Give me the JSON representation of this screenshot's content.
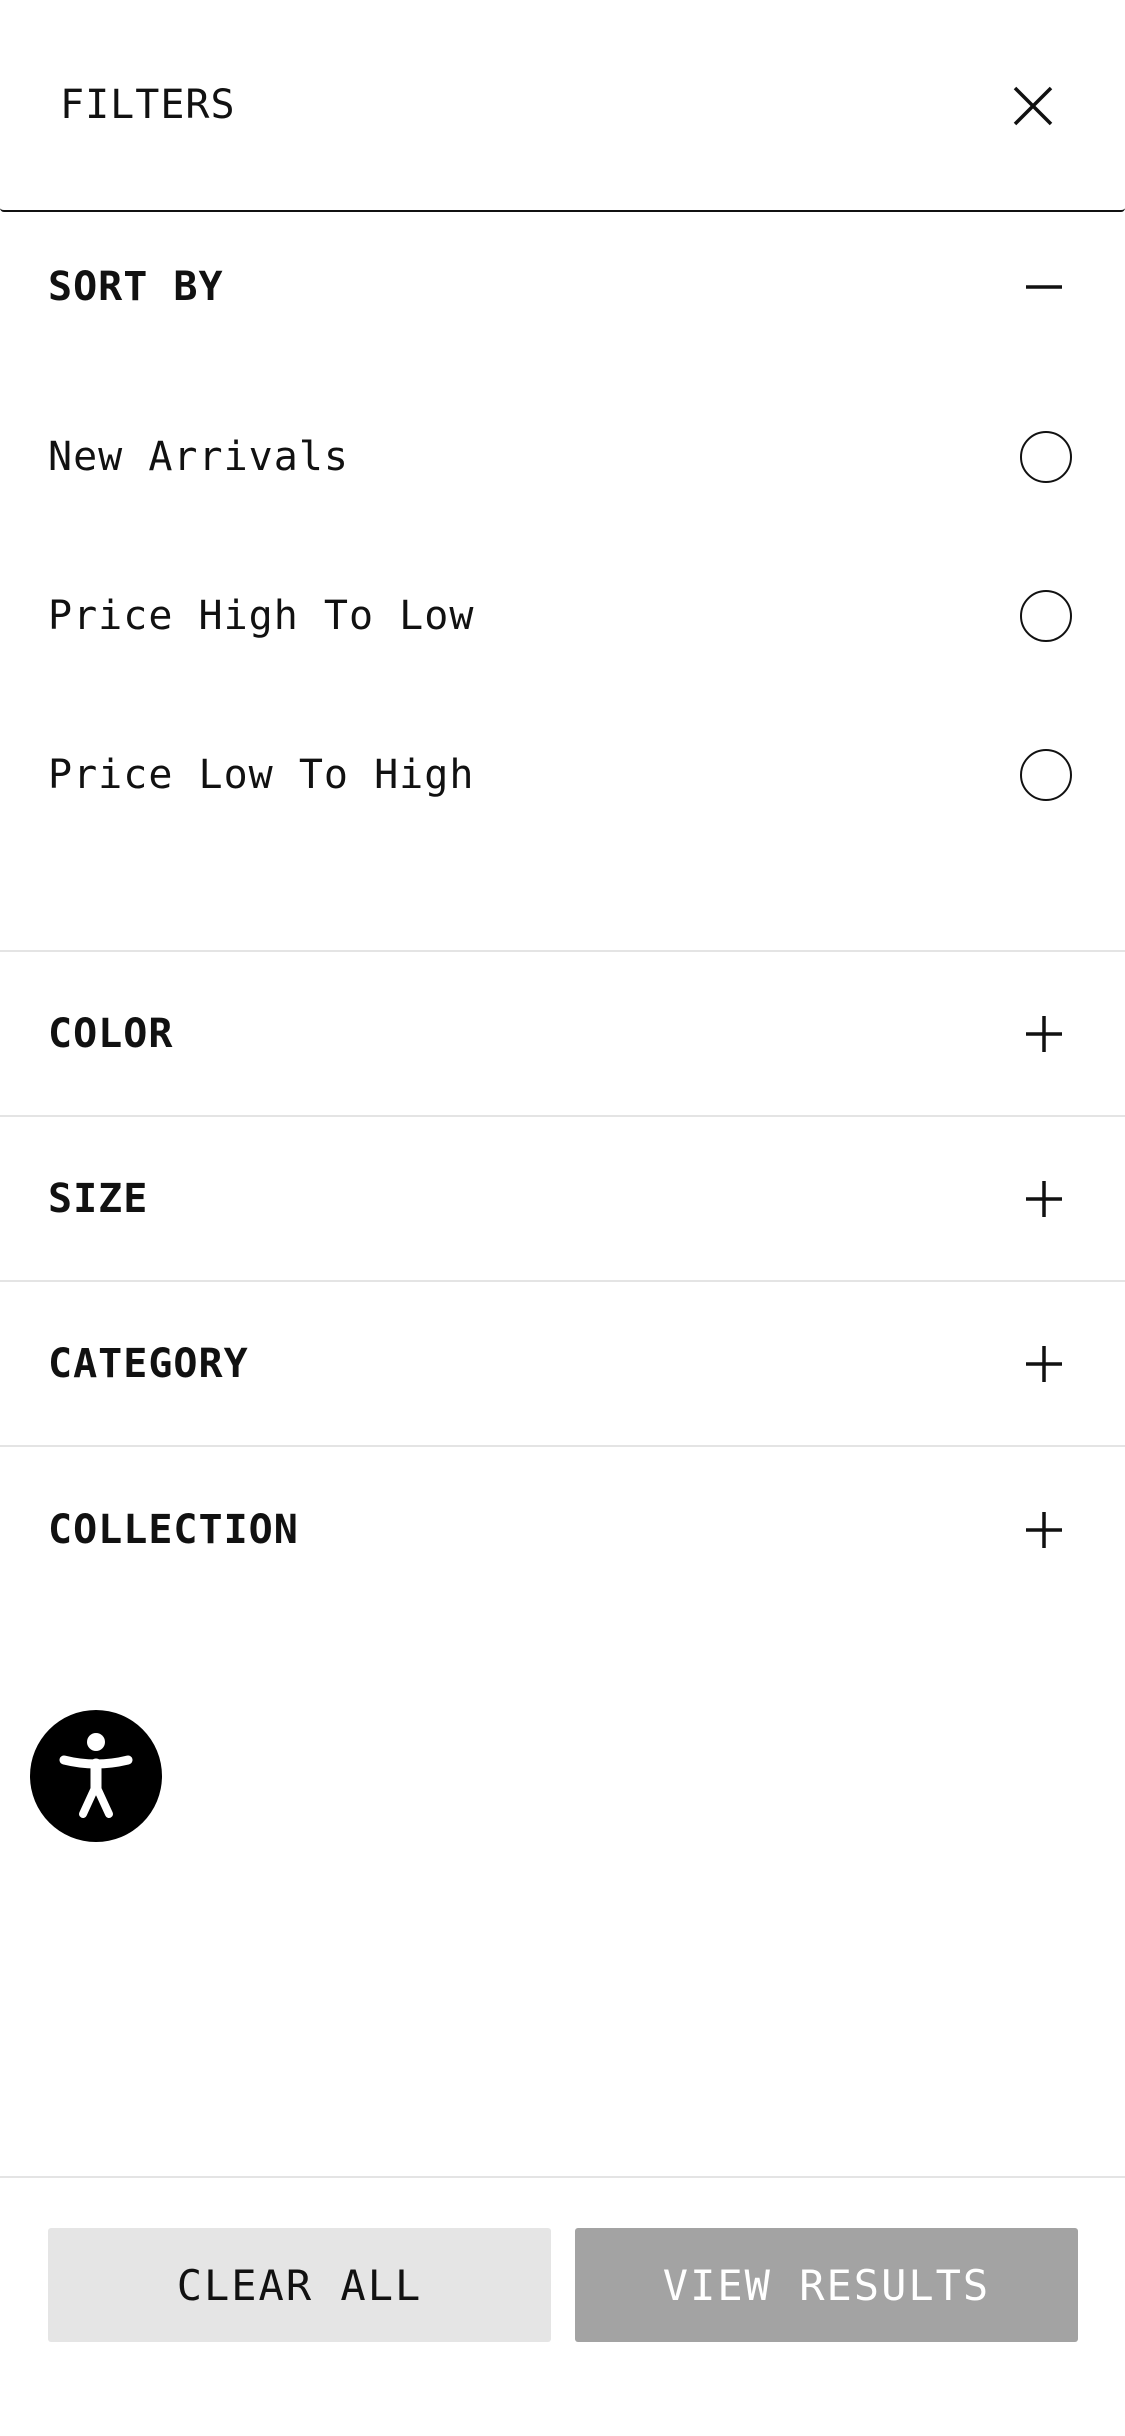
{
  "header": {
    "title": "FILTERS",
    "close_icon": "close-icon"
  },
  "sort": {
    "label": "SORT BY",
    "toggle_icon": "minus-icon",
    "options": [
      {
        "label": "New Arrivals",
        "selected": false
      },
      {
        "label": "Price High To Low",
        "selected": false
      },
      {
        "label": "Price Low To High",
        "selected": false
      }
    ]
  },
  "filters": [
    {
      "label": "COLOR",
      "toggle_icon": "plus-icon"
    },
    {
      "label": "SIZE",
      "toggle_icon": "plus-icon"
    },
    {
      "label": "CATEGORY",
      "toggle_icon": "plus-icon"
    },
    {
      "label": "COLLECTION",
      "toggle_icon": "plus-icon"
    }
  ],
  "accessibility": {
    "icon": "accessibility-icon"
  },
  "footer": {
    "clear_label": "CLEAR ALL",
    "view_label": "VIEW RESULTS"
  },
  "colors": {
    "view_button_bg": "#a3a3a3",
    "clear_button_bg": "#e5e5e5",
    "divider": "#e4e4e4"
  }
}
